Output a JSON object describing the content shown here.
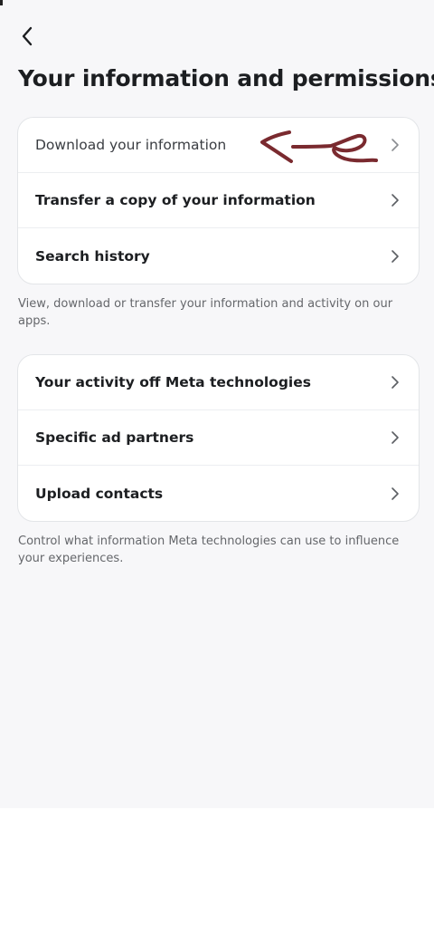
{
  "header": {
    "back_icon": "chevron-left-icon",
    "title": "Your information and permissions"
  },
  "section_1": {
    "items": [
      {
        "label": "Download your information",
        "icon": "chevron-right-icon"
      },
      {
        "label": "Transfer a copy of your information",
        "icon": "chevron-right-icon"
      },
      {
        "label": "Search history",
        "icon": "chevron-right-icon"
      }
    ],
    "caption": "View, download or transfer your information and activity on our apps."
  },
  "section_2": {
    "items": [
      {
        "label": "Your activity off Meta technologies",
        "icon": "chevron-right-icon"
      },
      {
        "label": "Specific ad partners",
        "icon": "chevron-right-icon"
      },
      {
        "label": "Upload contacts",
        "icon": "chevron-right-icon"
      }
    ],
    "caption": "Control what information Meta technologies can use to influence your experiences."
  },
  "annotation": {
    "icon": "handdrawn-arrow-icon",
    "color": "#7a2a2f"
  },
  "colors": {
    "background": "#f7f7f9",
    "card": "#ffffff",
    "text": "#1c1e21",
    "secondary_text": "#65676b"
  }
}
